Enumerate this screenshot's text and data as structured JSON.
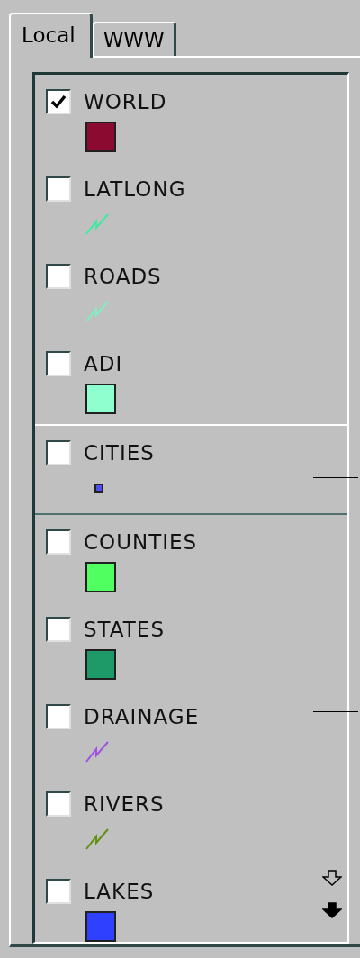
{
  "tabs": [
    {
      "label": "Local",
      "selected": true
    },
    {
      "label": "WWW",
      "selected": false
    }
  ],
  "layer_groups": [
    {
      "kind": "raised",
      "layers": [
        {
          "name": "WORLD",
          "checked": true,
          "kind": "fill",
          "color": "#8b0a30"
        },
        {
          "name": "LATLONG",
          "checked": false,
          "kind": "line",
          "color": "#40e8a0"
        },
        {
          "name": "ROADS",
          "checked": false,
          "kind": "line",
          "color": "#80f0c0"
        },
        {
          "name": "ADI",
          "checked": false,
          "kind": "fill",
          "color": "#90ffd0"
        }
      ]
    },
    {
      "kind": "sunken",
      "layers": [
        {
          "name": "CITIES",
          "checked": false,
          "kind": "point",
          "color": "#5050f0"
        }
      ]
    },
    {
      "kind": "plain",
      "layers": [
        {
          "name": "COUNTIES",
          "checked": false,
          "kind": "fill",
          "color": "#50ff60"
        },
        {
          "name": "STATES",
          "checked": false,
          "kind": "fill",
          "color": "#1e9a68"
        },
        {
          "name": "DRAINAGE",
          "checked": false,
          "kind": "line",
          "color": "#a050e0"
        },
        {
          "name": "RIVERS",
          "checked": false,
          "kind": "line",
          "color": "#609010"
        },
        {
          "name": "LAKES",
          "checked": false,
          "kind": "fill",
          "color": "#3040ff"
        }
      ]
    }
  ]
}
